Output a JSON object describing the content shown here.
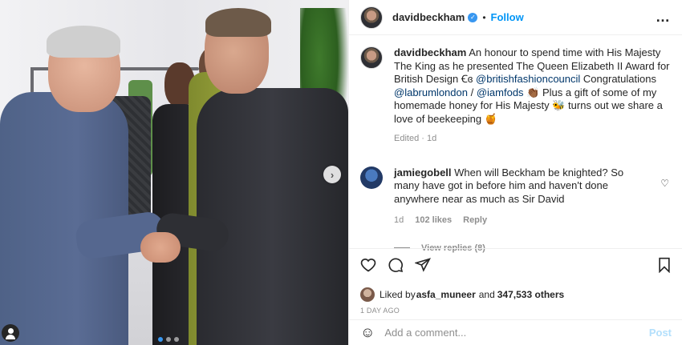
{
  "post": {
    "dots_count": 3
  },
  "header": {
    "username": "davidbeckham",
    "separator": "•",
    "follow_label": "Follow",
    "more_icon": "…"
  },
  "caption": {
    "username": "davidbeckham",
    "part1": " An honour to spend time with His Majesty The King as he presented The Queen Elizabeth II Award for British Design ",
    "glyph": "Ꞓɞ",
    "mention1": "@britishfashioncouncil",
    "part2": " Congratulations ",
    "mention2": "@labrumlondon",
    "slash": " / ",
    "mention3": "@iamfods",
    "part3": " 👏🏾 Plus a gift of some of my homemade honey for His Majesty 🐝 turns out we share a love of beekeeping 🍯",
    "edited": "Edited",
    "dot": " · ",
    "time": "1d"
  },
  "comment": {
    "username": "jamiegobell",
    "text": " When will Beckham be knighted? So many have got in before him and haven't done anywhere near as much as Sir David",
    "time": "1d",
    "likes": "102 likes",
    "reply_label": "Reply",
    "view_replies": "View replies (8)"
  },
  "likes": {
    "prefix": "Liked by ",
    "user": "asfa_muneer",
    "mid": " and ",
    "count": "347,533 others"
  },
  "posted_ago": "1 DAY AGO",
  "add_comment": {
    "placeholder": "Add a comment...",
    "post_label": "Post"
  },
  "colors": {
    "accent": "#0095f6",
    "link": "#00376b",
    "muted": "#8e8e8e",
    "post_disabled": "#b2dffc"
  }
}
